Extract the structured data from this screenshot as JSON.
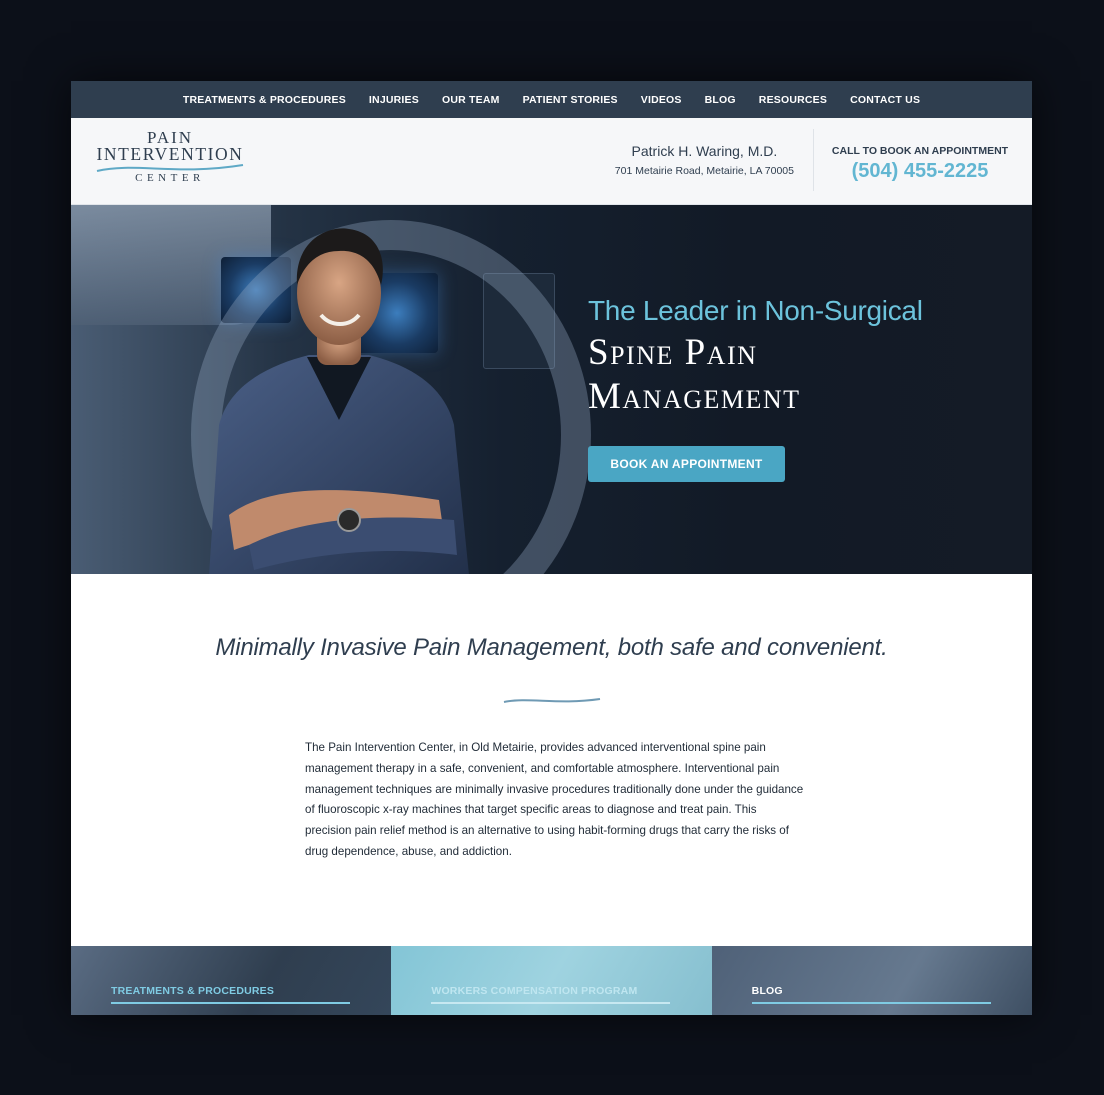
{
  "nav": {
    "items": [
      "TREATMENTS & PROCEDURES",
      "INJURIES",
      "OUR TEAM",
      "PATIENT STORIES",
      "VIDEOS",
      "BLOG",
      "RESOURCES",
      "CONTACT US"
    ]
  },
  "header": {
    "logo": {
      "line1": "PAIN",
      "line2": "INTERVENTION",
      "line3": "CENTER"
    },
    "doctor_name": "Patrick H. Waring, M.D.",
    "address": "701 Metairie Road, Metairie, LA 70005",
    "cta_label": "CALL TO BOOK AN APPOINTMENT",
    "phone": "(504) 455-2225"
  },
  "hero": {
    "headline_line1": "The Leader in Non-Surgical",
    "headline_line2": "Spine Pain",
    "headline_line3": "Management",
    "button_label": "BOOK AN APPOINTMENT"
  },
  "intro": {
    "tagline": "Minimally Invasive Pain Management, both safe and convenient.",
    "body": "The Pain Intervention Center, in Old Metairie, provides advanced interventional spine pain management therapy in a safe, convenient, and comfortable atmosphere. Interventional pain management techniques are minimally invasive procedures traditionally done under the guidance of fluoroscopic x-ray machines that target specific areas to diagnose and treat pain. This precision pain relief method is an alternative to using habit-forming drugs that carry the risks of drug dependence, abuse, and addiction."
  },
  "tiles": [
    {
      "label": "TREATMENTS & PROCEDURES"
    },
    {
      "label": "WORKERS COMPENSATION PROGRAM"
    },
    {
      "label": "BLOG"
    }
  ],
  "colors": {
    "nav_bg": "#2f3e4f",
    "accent": "#62b6d2",
    "button": "#4aa6c4",
    "page_bg": "#0c1019"
  }
}
